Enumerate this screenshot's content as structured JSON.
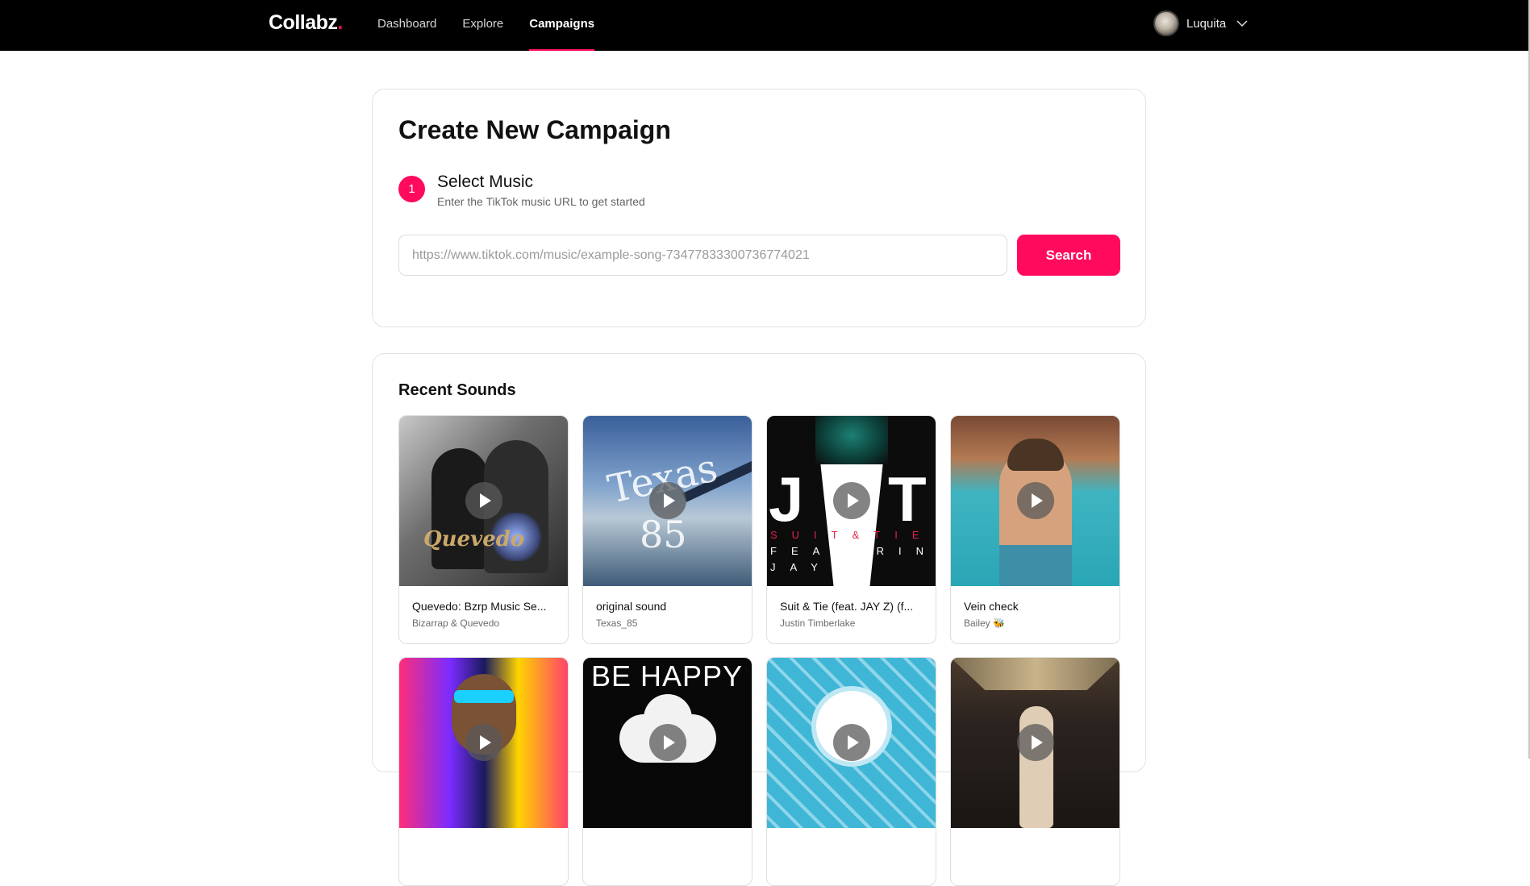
{
  "header": {
    "logo": "Collabz",
    "logo_dot": ".",
    "nav": [
      {
        "label": "Dashboard",
        "active": false
      },
      {
        "label": "Explore",
        "active": false
      },
      {
        "label": "Campaigns",
        "active": true
      }
    ],
    "user": {
      "name": "Luquita",
      "avatar_icon": "user-avatar",
      "menu_icon": "chevron-down-icon"
    }
  },
  "create": {
    "title": "Create New Campaign",
    "step": {
      "number": "1",
      "title": "Select Music",
      "subtitle": "Enter the TikTok music URL to get started"
    },
    "url_input": {
      "value": "",
      "placeholder": "https://www.tiktok.com/music/example-song-7347783330073677402​1"
    },
    "search_label": "Search"
  },
  "recent": {
    "title": "Recent Sounds",
    "sounds": [
      {
        "title": "Quevedo: Bzrp Music Se...",
        "artist": "Bizarrap & Quevedo"
      },
      {
        "title": "original sound",
        "artist": "Texas_85"
      },
      {
        "title": "Suit & Tie (feat. JAY Z) (f...",
        "artist": "Justin Timberlake"
      },
      {
        "title": "Vein check",
        "artist": "Bailey 🐝"
      },
      {
        "title": "",
        "artist": ""
      },
      {
        "title": "",
        "artist": ""
      },
      {
        "title": "",
        "artist": ""
      },
      {
        "title": "",
        "artist": ""
      }
    ],
    "cover_text": {
      "c1": "Quevedo",
      "c2_a": "Texas",
      "c2_b": "85",
      "c3_j": "J",
      "c3_t": "T",
      "c3_row1": "SUIT&TIE",
      "c3_row2": "FEATURING",
      "c3_row3": "JAYZ",
      "c6": "BE HAPPY"
    }
  },
  "colors": {
    "accent": "#ff0a5c",
    "topbar": "#000000"
  }
}
